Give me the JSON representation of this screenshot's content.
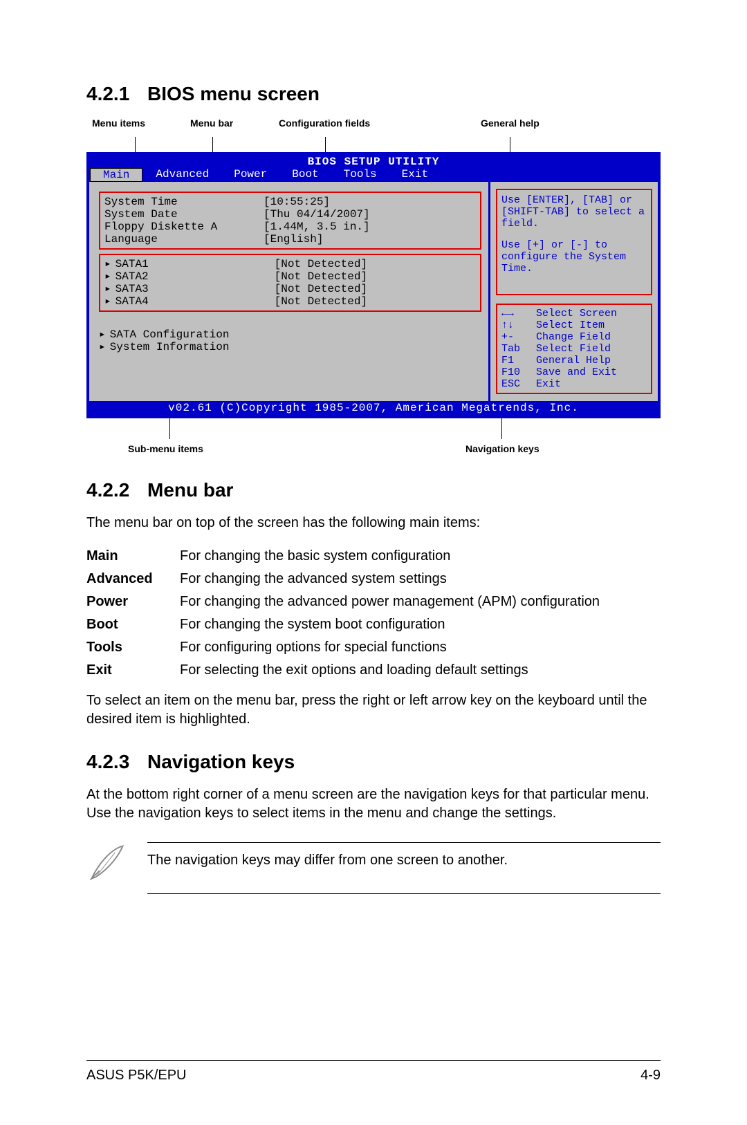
{
  "sections": {
    "s1": {
      "num": "4.2.1",
      "title": "BIOS menu screen"
    },
    "s2": {
      "num": "4.2.2",
      "title": "Menu bar",
      "intro": "The menu bar on top of the screen has the following main items:",
      "rows": [
        {
          "term": "Main",
          "desc": "For changing the basic system configuration"
        },
        {
          "term": "Advanced",
          "desc": "For changing the advanced system settings"
        },
        {
          "term": "Power",
          "desc": "For changing the advanced power management (APM) configuration"
        },
        {
          "term": "Boot",
          "desc": "For changing the system boot configuration"
        },
        {
          "term": "Tools",
          "desc": "For configuring options for special functions"
        },
        {
          "term": "Exit",
          "desc": "For selecting the exit options and loading default settings"
        }
      ],
      "outro": "To select an item on the menu bar, press the right or left arrow key on the keyboard until the desired item is highlighted."
    },
    "s3": {
      "num": "4.2.3",
      "title": "Navigation keys",
      "body": "At the bottom right corner of a menu screen are the navigation keys for that particular menu. Use the navigation keys to select items in the menu and change the settings."
    }
  },
  "callouts_top": {
    "c1": "Menu items",
    "c2": "Menu bar",
    "c3": "Configuration fields",
    "c4": "General help"
  },
  "callouts_bottom": {
    "c1": "Sub-menu items",
    "c2": "Navigation keys"
  },
  "bios": {
    "title": "BIOS SETUP UTILITY",
    "tabs": [
      "Main",
      "Advanced",
      "Power",
      "Boot",
      "Tools",
      "Exit"
    ],
    "group1": [
      {
        "lbl": "System Time",
        "val": "[10:55:25]"
      },
      {
        "lbl": "System Date",
        "val": "[Thu 04/14/2007]"
      },
      {
        "lbl": "Floppy Diskette A",
        "val": "[1.44M, 3.5 in.]"
      },
      {
        "lbl": "Language",
        "val": "[English]"
      }
    ],
    "group2": [
      {
        "lbl": "SATA1",
        "val": "[Not Detected]"
      },
      {
        "lbl": "SATA2",
        "val": "[Not Detected]"
      },
      {
        "lbl": "SATA3",
        "val": "[Not Detected]"
      },
      {
        "lbl": "SATA4",
        "val": "[Not Detected]"
      }
    ],
    "group3": [
      {
        "lbl": "SATA Configuration"
      },
      {
        "lbl": "System Information"
      }
    ],
    "help1": "Use [ENTER], [TAB] or [SHIFT-TAB] to select a field.",
    "help2": "Use [+] or [-] to configure the System Time.",
    "nav": [
      {
        "k": "←→",
        "d": "Select Screen"
      },
      {
        "k": "↑↓",
        "d": "Select Item"
      },
      {
        "k": "+-",
        "d": "Change Field"
      },
      {
        "k": "Tab",
        "d": "Select Field"
      },
      {
        "k": "F1",
        "d": "General Help"
      },
      {
        "k": "F10",
        "d": "Save and Exit"
      },
      {
        "k": "ESC",
        "d": "Exit"
      }
    ],
    "footer": "v02.61 (C)Copyright 1985-2007, American Megatrends, Inc."
  },
  "note": "The navigation keys may differ from one screen to another.",
  "footer": {
    "left": "ASUS P5K/EPU",
    "right": "4-9"
  }
}
